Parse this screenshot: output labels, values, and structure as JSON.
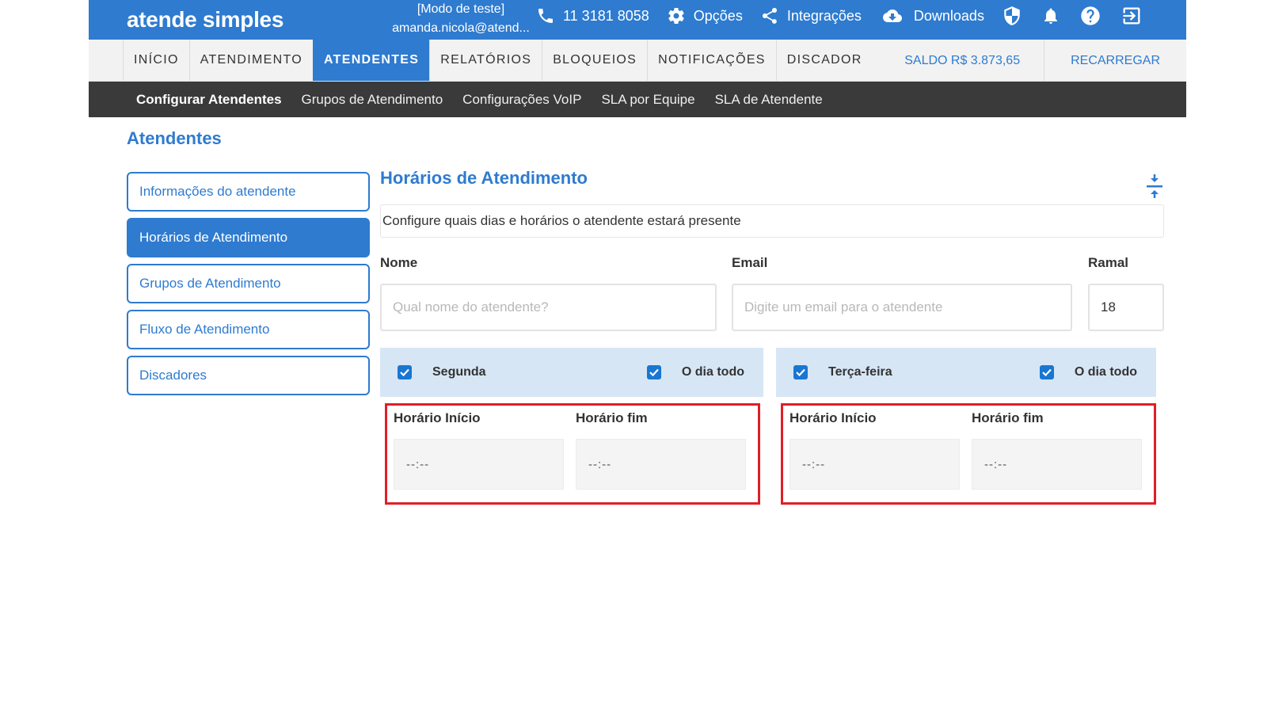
{
  "header": {
    "logo": "atende simples",
    "mode": "[Modo de teste]",
    "email": "amanda.nicola@atend...",
    "phone": "11 3181 8058",
    "options": "Opções",
    "integrations": "Integrações",
    "downloads": "Downloads"
  },
  "mainnav": {
    "items": [
      "INÍCIO",
      "ATENDIMENTO",
      "ATENDENTES",
      "RELATÓRIOS",
      "BLOQUEIOS",
      "NOTIFICAÇÕES",
      "DISCADOR"
    ],
    "saldo": "SALDO R$ 3.873,65",
    "recarregar": "RECARREGAR"
  },
  "subnav": {
    "items": [
      "Configurar Atendentes",
      "Grupos de Atendimento",
      "Configurações VoIP",
      "SLA por Equipe",
      "SLA de Atendente"
    ]
  },
  "page": {
    "title": "Atendentes"
  },
  "side": {
    "items": [
      "Informações do atendente",
      "Horários de Atendimento",
      "Grupos de Atendimento",
      "Fluxo de Atendimento",
      "Discadores"
    ]
  },
  "content": {
    "title": "Horários de Atendimento",
    "description": "Configure quais dias e horários o atendente estará presente",
    "name_label": "Nome",
    "name_placeholder": "Qual nome do atendente?",
    "email_label": "Email",
    "email_placeholder": "Digite um email para o atendente",
    "ramal_label": "Ramal",
    "ramal_value": "18"
  },
  "days": [
    {
      "name": "Segunda",
      "allday": "O dia todo",
      "start_label": "Horário Início",
      "end_label": "Horário fim",
      "start": "--:--",
      "end": "--:--"
    },
    {
      "name": "Terça-feira",
      "allday": "O dia todo",
      "start_label": "Horário Início",
      "end_label": "Horário fim",
      "start": "--:--",
      "end": "--:--"
    }
  ],
  "colors": {
    "primary": "#2e7bd0",
    "subnav": "#3a3a3a",
    "dayhead": "#d7e6f5",
    "highlight": "#e01e26"
  }
}
